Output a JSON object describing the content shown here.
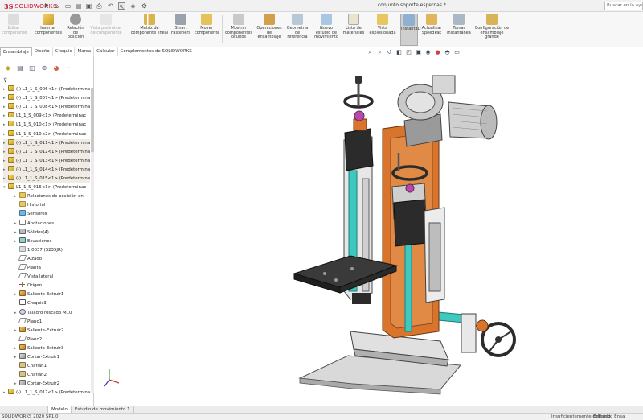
{
  "titlebar": {
    "logo_prefix": "3S",
    "logo_text": "SOLIDWORKS",
    "doc_title": "conjunto soporte espernas *",
    "search_placeholder": "Buscar en la ayuda"
  },
  "ribbon": {
    "buttons": [
      {
        "name": "editar-componente",
        "label": "Editar componente",
        "disabled": true
      },
      {
        "name": "insertar-componentes",
        "label": "Insertar componentes"
      },
      {
        "name": "relacion-posicion",
        "label": "Relación de posición"
      },
      {
        "name": "vista-previa",
        "label": "Vista preliminar de componente",
        "disabled": true
      },
      {
        "name": "matriz-componente-lineal",
        "label": "Matriz de componente lineal"
      },
      {
        "name": "smart-fasteners",
        "label": "Smart Fasteners"
      },
      {
        "name": "mover-componente",
        "label": "Mover componente"
      },
      {
        "name": "mostrar-componentes-ocultos",
        "label": "Mostrar componentes ocultos"
      },
      {
        "name": "operaciones-ensamblaje",
        "label": "Operaciones de ensamblaje"
      },
      {
        "name": "geometria-referencia",
        "label": "Geometría de referencia"
      },
      {
        "name": "nuevo-estudio-movimiento",
        "label": "Nuevo estudio de movimiento"
      },
      {
        "name": "lista-materiales",
        "label": "Lista de materiales"
      },
      {
        "name": "vista-explosionada",
        "label": "Vista explosionada"
      },
      {
        "name": "instant3d",
        "label": "Instant3D",
        "active": true
      },
      {
        "name": "actualizar-speedpak",
        "label": "Actualizar SpeedPak"
      },
      {
        "name": "tomar-instantanea",
        "label": "Tomar instantánea"
      },
      {
        "name": "configuracion-ensamblaje",
        "label": "Configuración de ensamblaje grande"
      }
    ]
  },
  "tabs": [
    "Ensamblaje",
    "Diseño",
    "Croquis",
    "Marca",
    "Calcular",
    "Complementos de SOLIDWORKS"
  ],
  "tree": [
    {
      "label": "(-) L1_1_S_006<1> (Predetermina",
      "icon": "part",
      "toggle": "▸",
      "indent": 0
    },
    {
      "label": "(-) L1_1_S_007<1> (Predetermina",
      "icon": "part",
      "toggle": "▸",
      "indent": 0
    },
    {
      "label": "(-) L1_1_S_008<1> (Predetermina",
      "icon": "part",
      "toggle": "▸",
      "indent": 0
    },
    {
      "label": "L1_1_S_009<1> (Predeterminac",
      "icon": "part",
      "toggle": "▸",
      "indent": 0
    },
    {
      "label": "L1_1_S_010<1> (Predeterminac",
      "icon": "part",
      "toggle": "▸",
      "indent": 0
    },
    {
      "label": "L1_1_S_010<2> (Predeterminac",
      "icon": "part",
      "toggle": "▸",
      "indent": 0
    },
    {
      "label": "(-) L1_1_S_011<1> (Predetermina",
      "icon": "part",
      "toggle": "▸",
      "indent": 0
    },
    {
      "label": "(-) L1_1_S_012<1> (Predetermina",
      "icon": "part",
      "toggle": "▸",
      "indent": 0
    },
    {
      "label": "(-) L1_1_S_013<1> (Predetermina",
      "icon": "part",
      "toggle": "▸",
      "indent": 0
    },
    {
      "label": "(-) L1_1_S_014<1> (Predetermina",
      "icon": "part",
      "toggle": "▸",
      "indent": 0
    },
    {
      "label": "(-) L1_1_S_015<1> (Predetermina",
      "icon": "part",
      "toggle": "▸",
      "indent": 0
    },
    {
      "label": "L1_1_S_016<1> (Predeterminac",
      "icon": "part",
      "toggle": "▾",
      "indent": 0
    },
    {
      "label": "Relaciones de posición en",
      "icon": "folder",
      "toggle": "▸",
      "indent": 1
    },
    {
      "label": "Historial",
      "icon": "folder",
      "toggle": "",
      "indent": 1
    },
    {
      "label": "Sensores",
      "icon": "sens",
      "toggle": "",
      "indent": 1
    },
    {
      "label": "Anotaciones",
      "icon": "annot",
      "toggle": "▸",
      "indent": 1
    },
    {
      "label": "Sólidos(4)",
      "icon": "solid",
      "toggle": "▸",
      "indent": 1
    },
    {
      "label": "Ecuaciones",
      "icon": "eq",
      "toggle": "▸",
      "indent": 1
    },
    {
      "label": "1.0037 (S235JR)",
      "icon": "mat",
      "toggle": "",
      "indent": 1
    },
    {
      "label": "Alzado",
      "icon": "plane",
      "toggle": "",
      "indent": 1
    },
    {
      "label": "Planta",
      "icon": "plane",
      "toggle": "",
      "indent": 1
    },
    {
      "label": "Vista lateral",
      "icon": "plane",
      "toggle": "",
      "indent": 1
    },
    {
      "label": "Origen",
      "icon": "orig",
      "toggle": "",
      "indent": 1
    },
    {
      "label": "Saliente-Extruir1",
      "icon": "feat",
      "toggle": "▸",
      "indent": 1
    },
    {
      "label": "Croquis3",
      "icon": "sk",
      "toggle": "",
      "indent": 1
    },
    {
      "label": "Taladro roscado M10",
      "icon": "hole",
      "toggle": "▸",
      "indent": 1
    },
    {
      "label": "Plano1",
      "icon": "plane",
      "toggle": "",
      "indent": 1
    },
    {
      "label": "Saliente-Extruir2",
      "icon": "feat",
      "toggle": "▸",
      "indent": 1
    },
    {
      "label": "Plano2",
      "icon": "plane",
      "toggle": "",
      "indent": 1
    },
    {
      "label": "Saliente-Extruir3",
      "icon": "feat",
      "toggle": "▸",
      "indent": 1
    },
    {
      "label": "Cortar-Extruir1",
      "icon": "cut",
      "toggle": "▸",
      "indent": 1
    },
    {
      "label": "Chaflán1",
      "icon": "ch",
      "toggle": "",
      "indent": 1
    },
    {
      "label": "Chaflán2",
      "icon": "ch",
      "toggle": "",
      "indent": 1
    },
    {
      "label": "Cortar-Extruir2",
      "icon": "cut",
      "toggle": "▸",
      "indent": 1
    },
    {
      "label": "(-) L1_1_S_017<1> (Predetermina",
      "icon": "part",
      "toggle": "▸",
      "indent": 0
    }
  ],
  "bottom_tabs": [
    "",
    "Modelo",
    "Estudio de movimiento 1"
  ],
  "status": {
    "version": "SOLIDWORKS 2020 SP1.0",
    "definition": "Insuficientemente definido",
    "editing": "Editando Ensa"
  },
  "colors": {
    "frame_orange": "#d9742c",
    "body_dark": "#2b2b2b",
    "rail_cyan": "#3fc8c0",
    "motor_gray": "#c9c9c9"
  }
}
